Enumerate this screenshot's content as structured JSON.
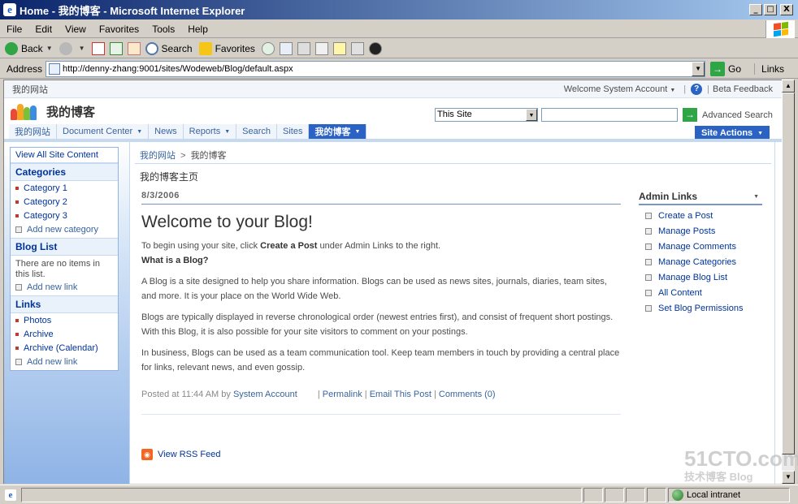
{
  "window": {
    "title": "Home - 我的博客 - Microsoft Internet Explorer",
    "minimize": "_",
    "maximize": "□",
    "close": "X"
  },
  "menu": [
    "File",
    "Edit",
    "View",
    "Favorites",
    "Tools",
    "Help"
  ],
  "toolbar": {
    "back": "Back",
    "search": "Search",
    "favorites": "Favorites"
  },
  "address": {
    "label": "Address",
    "url": "http://denny-zhang:9001/sites/Wodeweb/Blog/default.aspx",
    "go": "Go",
    "links": "Links"
  },
  "global": {
    "site": "我的网站",
    "welcome": "Welcome System Account",
    "beta": "Beta Feedback"
  },
  "site_title": "我的博客",
  "search": {
    "scope": "This Site",
    "advanced": "Advanced Search"
  },
  "topnav": [
    {
      "label": "我的网站",
      "dropdown": false
    },
    {
      "label": "Document Center",
      "dropdown": true
    },
    {
      "label": "News",
      "dropdown": false
    },
    {
      "label": "Reports",
      "dropdown": true
    },
    {
      "label": "Search",
      "dropdown": false
    },
    {
      "label": "Sites",
      "dropdown": false
    },
    {
      "label": "我的博客",
      "dropdown": true,
      "selected": true
    }
  ],
  "site_actions": "Site Actions",
  "leftnav": {
    "view_all": "View All Site Content",
    "categories_header": "Categories",
    "categories": [
      "Category 1",
      "Category 2",
      "Category 3"
    ],
    "add_category": "Add new category",
    "bloglist_header": "Blog List",
    "bloglist_empty": "There are no items in this list.",
    "add_link": "Add new link",
    "links_header": "Links",
    "links": [
      "Photos",
      "Archive",
      "Archive (Calendar)"
    ],
    "add_link2": "Add new link"
  },
  "breadcrumb": {
    "root": "我的网站",
    "sep": ">",
    "current": "我的博客"
  },
  "page_title": "我的博客主页",
  "post": {
    "date": "8/3/2006",
    "title": "Welcome to your Blog!",
    "intro_prefix": "To begin using your site, click ",
    "intro_bold": "Create a Post",
    "intro_suffix": " under Admin Links to the right.",
    "question": "What is a Blog?",
    "p1": "A Blog is a site designed to help you share information. Blogs can be used as news sites, journals, diaries, team sites, and more. It is your place on the World Wide Web.",
    "p2": "Blogs are typically displayed in reverse chronological order (newest entries first), and consist of frequent short postings. With this Blog, it is also possible for your site visitors to comment on your postings.",
    "p3": "In business, Blogs can be used as a team communication tool. Keep team members in touch by providing a central place for links, relevant news, and even gossip.",
    "posted_at": "Posted at 11:44 AM by",
    "author": "System Account",
    "permalink": "Permalink",
    "email": "Email This Post",
    "comments": "Comments (0)"
  },
  "rss": "View RSS Feed",
  "admin": {
    "header": "Admin Links",
    "links": [
      "Create a Post",
      "Manage Posts",
      "Manage Comments",
      "Manage Categories",
      "Manage Blog List",
      "All Content",
      "Set Blog Permissions"
    ]
  },
  "status": {
    "zone": "Local intranet"
  },
  "watermark": {
    "main": "51CTO.com",
    "sub": "技术博客  Blog"
  }
}
